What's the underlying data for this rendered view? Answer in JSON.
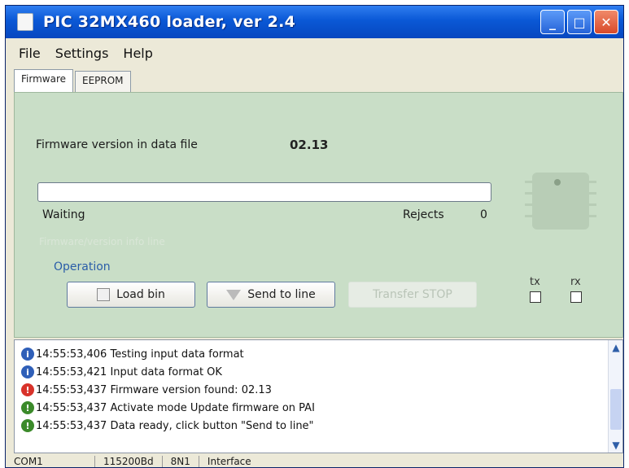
{
  "window": {
    "title": "PIC 32MX460 loader, ver 2.4"
  },
  "menu": [
    "File",
    "Settings",
    "Help"
  ],
  "tabs": [
    "Firmware",
    "EEPROM"
  ],
  "firmware": {
    "version_label": "Firmware version in data file",
    "version_value": "02.13",
    "progress": 0,
    "status": "Waiting",
    "rejects_label": "Rejects",
    "rejects_value": "0",
    "disabled_text": "Firmware/version info line",
    "operation_label": "Operation",
    "buttons": {
      "load": "Load bin",
      "send": "Send to line",
      "stop": "Transfer STOP"
    },
    "tx_label": "tx",
    "rx_label": "rx"
  },
  "log": [
    {
      "icon": "info-icon",
      "color": "#2f5fb8",
      "symbol": "i",
      "text": "14:55:53,406  Testing input data format"
    },
    {
      "icon": "info-icon",
      "color": "#2f5fb8",
      "symbol": "i",
      "text": "14:55:53,421  Input data format OK"
    },
    {
      "icon": "error-icon",
      "color": "#d8322a",
      "symbol": "!",
      "text": "14:55:53,437  Firmware version found:  02.13"
    },
    {
      "icon": "ok-icon",
      "color": "#3b8a2a",
      "symbol": "!",
      "text": "14:55:53,437  Activate mode Update firmware on PAI"
    },
    {
      "icon": "ok-icon",
      "color": "#3b8a2a",
      "symbol": "!",
      "text": "14:55:53,437  Data ready, click button \"Send to line\""
    }
  ],
  "status": {
    "port": "COM1",
    "baud": "115200Bd",
    "format": "8N1",
    "interface": "Interface"
  }
}
